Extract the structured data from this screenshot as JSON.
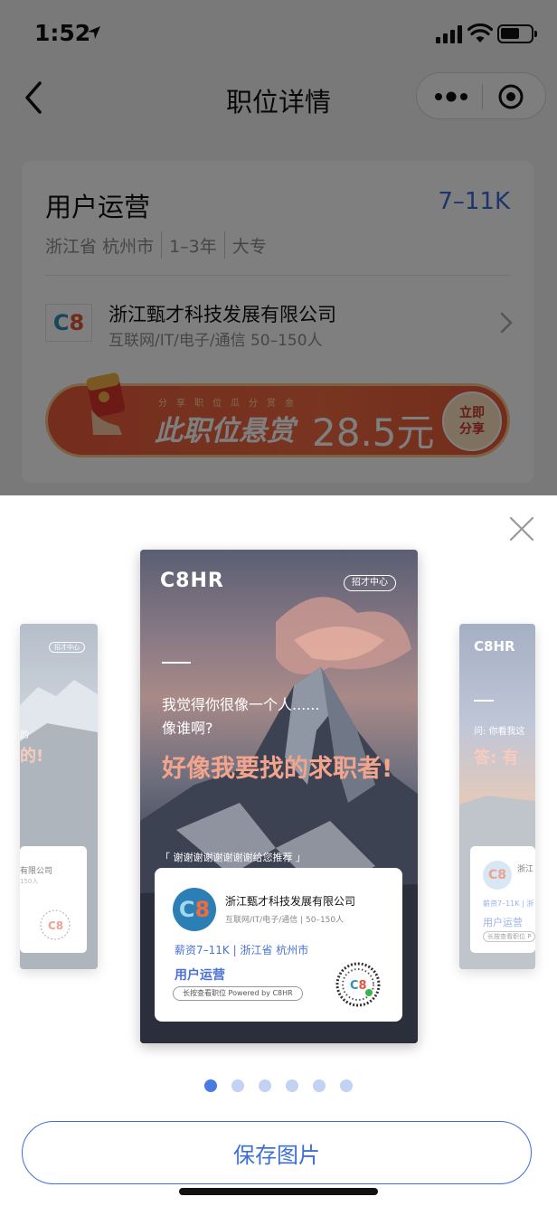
{
  "status": {
    "time": "1:52"
  },
  "nav": {
    "title": "职位详情"
  },
  "job": {
    "title": "用户运营",
    "salary": "7–11K",
    "province": "浙江省",
    "city": "杭州市",
    "experience": "1–3年",
    "education": "大专"
  },
  "company": {
    "logo_text": "C8",
    "name": "浙江甄才科技发展有限公司",
    "info": "互联网/IT/电子/通信 50–150人"
  },
  "reward": {
    "tagline": "分享职位瓜分赏金",
    "label": "此职位悬赏",
    "amount": "28.5元",
    "button_line1": "立即",
    "button_line2": "分享"
  },
  "poster": {
    "brand": "C8HR",
    "tag": "招才中心",
    "line1": "我觉得你很像一个人......",
    "line2": "像谁啊?",
    "headline": "好像我要找的求职者!",
    "thanks": "「 谢谢谢谢谢谢谢谢给您推荐 」",
    "card_logo": "C8",
    "card_company": "浙江甄才科技发展有限公司",
    "card_sub": "互联网/IT/电子/通信 | 50–150人",
    "card_salary": "薪资7–11K | 浙江省 杭州市",
    "card_job": "用户运营",
    "card_pill": "长按查看职位  Powered by C8HR"
  },
  "poster_left": {
    "tag": "招才中心",
    "text1": "的",
    "big": "的!",
    "card_line1": "有限公司",
    "card_line2": "150人"
  },
  "poster_right": {
    "brand": "C8HR",
    "text1": "问: 你看我这",
    "big": "答: 有",
    "card_logo": "C8",
    "card_line1": "浙江",
    "card_line2": "薪资7–11K | 浙",
    "card_job": "用户运营",
    "card_pill": "长按查看职位  P"
  },
  "carousel": {
    "count": 6,
    "active_index": 0
  },
  "actions": {
    "save_label": "保存图片"
  }
}
